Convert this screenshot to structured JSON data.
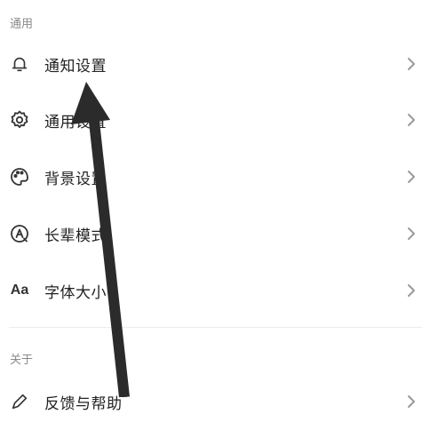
{
  "sections": {
    "general_title": "通用",
    "about_title": "关于"
  },
  "rows": [
    {
      "label": "通知设置",
      "icon": "bell-icon"
    },
    {
      "label": "通用设置",
      "icon": "gear-icon"
    },
    {
      "label": "背景设置",
      "icon": "palette-icon"
    },
    {
      "label": "长辈模式",
      "icon": "elder-mode-icon"
    },
    {
      "label": "字体大小",
      "icon": "font-size-icon",
      "icon_text": "Aa"
    },
    {
      "label": "反馈与帮助",
      "icon": "pen-icon"
    }
  ],
  "colors": {
    "text": "#222222",
    "section_header": "#8a8a8a",
    "chevron": "#9a9a9a",
    "annotation_arrow": "#2b2b2b"
  }
}
